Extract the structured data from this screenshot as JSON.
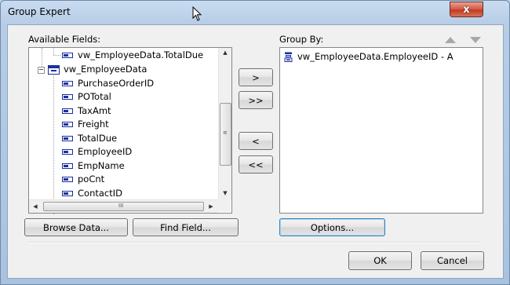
{
  "window": {
    "title": "Group Expert",
    "close_label": "x"
  },
  "available": {
    "label": "Available Fields:",
    "tree": {
      "top_item": "vw_EmployeeData.TotalDue",
      "group_node": "vw_EmployeeData",
      "fields": [
        "PurchaseOrderID",
        "POTotal",
        "TaxAmt",
        "Freight",
        "TotalDue",
        "EmployeeID",
        "EmpName",
        "poCnt",
        "ContactID"
      ]
    },
    "hscroll_grip": "III",
    "vscroll_grip": "≡"
  },
  "transfer_buttons": {
    "add": ">",
    "add_all": ">>",
    "remove": "<",
    "remove_all": "<<"
  },
  "group_by": {
    "label": "Group By:",
    "items": [
      "vw_EmployeeData.EmployeeID - A"
    ]
  },
  "buttons": {
    "browse_data": "Browse Data...",
    "find_field": "Find Field...",
    "options": "Options...",
    "ok": "OK",
    "cancel": "Cancel"
  },
  "icons": {
    "move_up": "triangle-up-icon",
    "move_down": "triangle-down-icon",
    "field": "field-icon",
    "table": "table-icon"
  },
  "colors": {
    "title_bar": "#b7cde6",
    "close_button": "#c23a22",
    "dialog_bg": "#f0f0f0",
    "icon_blue": "#1b2fa0",
    "default_button_border": "#3c7fb1"
  }
}
